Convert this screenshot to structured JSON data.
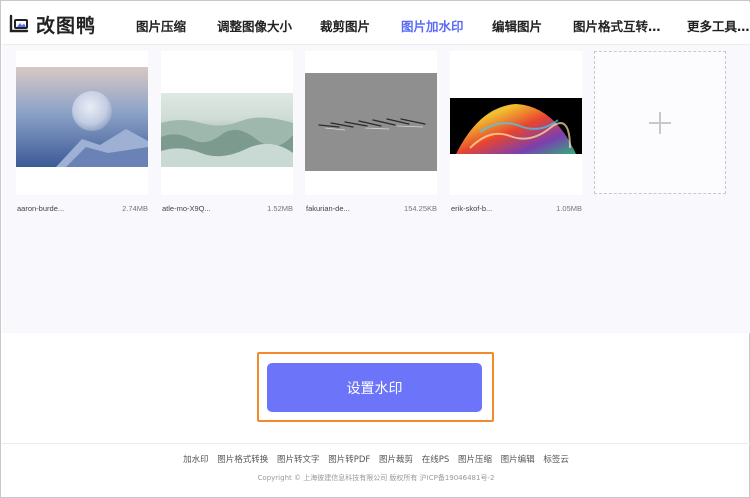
{
  "app": {
    "logo_text": "改图鸭"
  },
  "nav": {
    "items": [
      {
        "label": "图片压缩"
      },
      {
        "label": "调整图像大小"
      },
      {
        "label": "裁剪图片"
      },
      {
        "label": "图片加水印",
        "active": true
      },
      {
        "label": "编辑图片"
      },
      {
        "label": "图片格式互转…"
      },
      {
        "label": "更多工具…"
      }
    ]
  },
  "files": [
    {
      "name": "aaron-burde...",
      "size": "2.74MB",
      "thumb": "frozen-bubble"
    },
    {
      "name": "atle-mo-X9Q...",
      "size": "1.52MB",
      "thumb": "frosted-forest"
    },
    {
      "name": "fakurian-de...",
      "size": "154.25KB",
      "thumb": "gray-strokes"
    },
    {
      "name": "erik-skof-b...",
      "size": "1.05MB",
      "thumb": "soap-bubble"
    }
  ],
  "add_card": {
    "icon": "plus-icon"
  },
  "action": {
    "primary_label": "设置水印",
    "primary_color": "#6c75fa",
    "highlight_color": "#f28a2c"
  },
  "footer": {
    "links": [
      "加水印",
      "图片格式转换",
      "图片转文字",
      "图片转PDF",
      "图片裁剪",
      "在线PS",
      "图片压缩",
      "图片编辑",
      "标签云"
    ],
    "copyright": "Copyright © 上海彼建信息科技有限公司 版权所有 沪ICP备19046481号-2"
  },
  "colors": {
    "accent": "#5a6cf5",
    "upload_bg": "#f9f9fd"
  }
}
